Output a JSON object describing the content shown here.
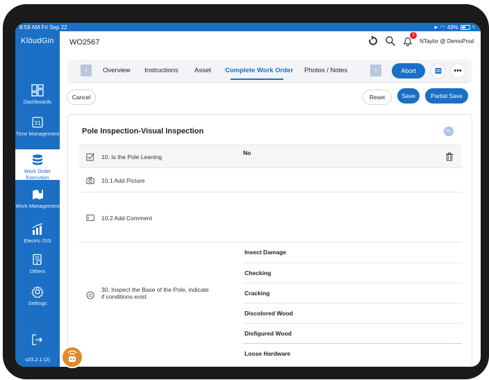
{
  "status": {
    "time_date": "8:59 AM  Fri Sep 22",
    "battery": "49%"
  },
  "sidebar": {
    "logo": "KlōudGin",
    "items": [
      {
        "label": "Dashboards",
        "icon": "dashboard-icon"
      },
      {
        "label": "Time Management",
        "icon": "time-icon"
      },
      {
        "label": "Work Order Execution",
        "icon": "database-icon",
        "active": true
      },
      {
        "label": "Work Management",
        "icon": "map-pin-icon"
      },
      {
        "label": "Electric GIS",
        "icon": "chart-icon"
      },
      {
        "label": "Others",
        "icon": "document-icon"
      },
      {
        "label": "Settings",
        "icon": "gear-icon"
      }
    ],
    "version": "v23.2.1 (2)"
  },
  "header": {
    "title": "WO2567",
    "notification_count": "1",
    "user": "NTaylor @ DemoProd"
  },
  "tabs": {
    "items": [
      "Overview",
      "Instructions",
      "Asset",
      "Complete Work Order",
      "Photos / Notes"
    ],
    "active": "Complete Work Order",
    "abort_label": "Abort"
  },
  "actions": {
    "cancel": "Cancel",
    "reset": "Reset",
    "save": "Save",
    "partial_save": "Partial Save"
  },
  "form": {
    "section_title": "Pole Inspection-Visual Inspection",
    "q10_label": "10.  Is the Pole Leaning",
    "q10_value": "No",
    "q10_1_label": "10.1  Add Picture",
    "q10_2_label": "10.2  Add Comment",
    "q30_label_line1": "30.  Inspect the Base of the Pole, indicate",
    "q30_label_line2": "if conditions exist",
    "q30_options": [
      "Insect Damage",
      "Checking",
      "Cracking",
      "Discolored Wood",
      "Disfigured Wood",
      "Loose Hardware"
    ]
  },
  "colors": {
    "brand_blue": "#1b6fc4",
    "badge_red": "#e02020",
    "helper_orange": "#e08a2c"
  }
}
